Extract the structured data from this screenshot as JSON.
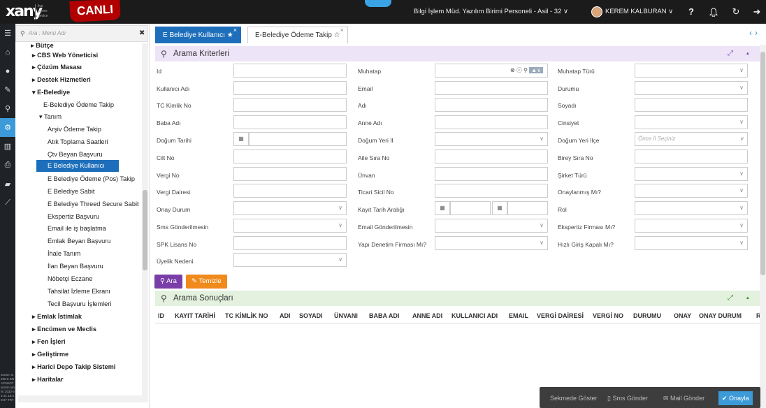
{
  "brand": {
    "logo": "xany",
    "logo_sub": "live where device",
    "env_badge": "CANLI"
  },
  "topbar": {
    "user_info": "Bilgi İşlem Müd. Yazılım Birimi Personeli - Asil - 32 ∨",
    "user_name": "KEREM KALBURAN ∨"
  },
  "version_text": "sürüm: 6.330.0-SNAPSHOT sürüm tarihi: 2022-01-21 15:40:07 TRT",
  "menu": {
    "search_placeholder": "Ara : Menü Adı",
    "items": [
      {
        "label": "▸ Bütçe"
      },
      {
        "label": "▸ CBS Web Yöneticisi"
      },
      {
        "label": "▸ Çözüm Masası"
      },
      {
        "label": "▸ Destek Hizmetleri"
      },
      {
        "label": "▾ E-Belediye"
      },
      {
        "label": "E-Belediye Ödeme Takip"
      },
      {
        "label": "▾ Tanım"
      },
      {
        "label": "Arşiv Ödeme Takip"
      },
      {
        "label": "Atık Toplama Saatleri"
      },
      {
        "label": "Çtv Beyan Başvuru"
      },
      {
        "label": "E Belediye Kullanıcı"
      },
      {
        "label": "E Belediye Ödeme (Pos) Takip"
      },
      {
        "label": "E Belediye Sabit"
      },
      {
        "label": "E Belediye Threed Secure Sabit"
      },
      {
        "label": "Ekspertiz Başvuru"
      },
      {
        "label": "Email ile iş başlatma"
      },
      {
        "label": "Emlak Beyan Başvuru"
      },
      {
        "label": "İhale Tanım"
      },
      {
        "label": "İlan Beyan Başvuru"
      },
      {
        "label": "Nöbetçi Eczane"
      },
      {
        "label": "Tahsilat İzleme Ekranı"
      },
      {
        "label": "Tecil Başvuru İşlemleri"
      },
      {
        "label": "▸ Emlak İstimlak"
      },
      {
        "label": "▸ Encümen ve Meclis"
      },
      {
        "label": "▸ Fen İşleri"
      },
      {
        "label": "▸ Geliştirme"
      },
      {
        "label": "▸ Harici Depo Takip Sistemi"
      },
      {
        "label": "▸ Haritalar"
      }
    ]
  },
  "tabs": [
    {
      "label": "E Belediye Kullanıcı ★"
    },
    {
      "label": "E-Belediye Ödeme Takip ☆"
    }
  ],
  "search_panel": {
    "title": "Arama Kriterleri",
    "fields": [
      {
        "label": "Id"
      },
      {
        "label": "Muhatap"
      },
      {
        "label": "Muhatap Türü"
      },
      {
        "label": "Kullanıcı Adı"
      },
      {
        "label": "Email"
      },
      {
        "label": "Durumu"
      },
      {
        "label": "TC Kimlik No"
      },
      {
        "label": "Adı"
      },
      {
        "label": "Soyadı"
      },
      {
        "label": "Baba Adı"
      },
      {
        "label": "Anne Adı"
      },
      {
        "label": "Cinsiyet"
      },
      {
        "label": "Doğum Tarihi"
      },
      {
        "label": "Doğum Yeri İl"
      },
      {
        "label": "Doğum Yeri İlçe"
      },
      {
        "label": "Cilt No"
      },
      {
        "label": "Aile Sıra No"
      },
      {
        "label": "Birey Sıra No"
      },
      {
        "label": "Vergi No"
      },
      {
        "label": "Ünvan"
      },
      {
        "label": "Şirket Türü"
      },
      {
        "label": "Vergi Dairesi"
      },
      {
        "label": "Ticari Sicil No"
      },
      {
        "label": "Onaylanmış Mı?"
      },
      {
        "label": "Onay Durum"
      },
      {
        "label": "Kayıt Tarih Aralığı"
      },
      {
        "label": "Rol"
      },
      {
        "label": "Sms Gönderilmesin"
      },
      {
        "label": "Email Gönderilmesin"
      },
      {
        "label": "Ekspertiz Firması Mı?"
      },
      {
        "label": "SPK Lisans No"
      },
      {
        "label": "Yapı Denetim Firması Mı?"
      },
      {
        "label": "Hızlı Giriş Kapalı Mı?"
      },
      {
        "label": "Üyelik Nedeni"
      }
    ],
    "ilce_placeholder": "Önce İl Seçiniz",
    "search_button": "Ara",
    "clear_button": "Temizle"
  },
  "results": {
    "title": "Arama Sonuçları",
    "columns": [
      "ID",
      "KAYIT TARİHİ",
      "TC KİMLİK NO",
      "ADI",
      "SOYADI",
      "ÜNVANI",
      "BABA ADI",
      "ANNE ADI",
      "KULLANICI ADI",
      "EMAIL",
      "VERGİ DAİRESİ",
      "VERGİ NO",
      "DURUMU",
      "ONAY",
      "ONAY DURUM",
      "R"
    ]
  },
  "actions": {
    "show_in_tab": "Sekmede Göster",
    "send_sms": "Sms Gönder",
    "send_mail": "Mail Gönder",
    "approve": "Onayla"
  },
  "colors": {
    "accent": "#1e6fbb",
    "panel_purple": "#ede4f7",
    "panel_green": "#e3f1de",
    "search_btn": "#7a3ea8",
    "clear_btn": "#f08a1c"
  }
}
